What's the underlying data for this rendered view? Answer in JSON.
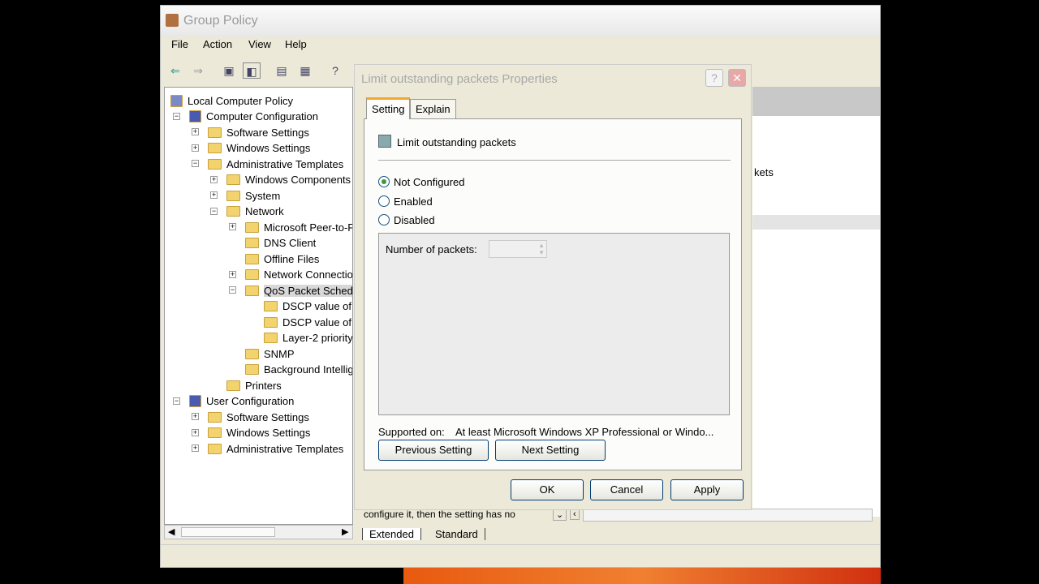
{
  "window": {
    "title": "Group Policy",
    "icon": "group-policy-icon"
  },
  "menu": [
    "File",
    "Action",
    "View",
    "Help"
  ],
  "toolbar": [
    "back-icon",
    "forward-icon",
    "up-folder-icon",
    "show-hide-tree-icon",
    "properties-icon",
    "export-list-icon",
    "help-icon"
  ],
  "tree": [
    {
      "label": "Local Computer Policy",
      "level": 0,
      "exp": "",
      "icon": "policy"
    },
    {
      "label": "Computer Configuration",
      "level": 0,
      "exp": "-",
      "icon": "computer"
    },
    {
      "label": "Software Settings",
      "level": 1,
      "exp": "+"
    },
    {
      "label": "Windows Settings",
      "level": 1,
      "exp": "+"
    },
    {
      "label": "Administrative Templates",
      "level": 1,
      "exp": "-"
    },
    {
      "label": "Windows Components",
      "level": 2,
      "exp": "+"
    },
    {
      "label": "System",
      "level": 2,
      "exp": "+"
    },
    {
      "label": "Network",
      "level": 2,
      "exp": "-"
    },
    {
      "label": "Microsoft Peer-to-F",
      "level": 3,
      "exp": "+"
    },
    {
      "label": "DNS Client",
      "level": 3,
      "exp": ""
    },
    {
      "label": "Offline Files",
      "level": 3,
      "exp": ""
    },
    {
      "label": "Network Connectio",
      "level": 3,
      "exp": "+"
    },
    {
      "label": "QoS Packet Schedu",
      "level": 3,
      "exp": "-",
      "selected": true
    },
    {
      "label": "DSCP value of",
      "level": 4,
      "exp": ""
    },
    {
      "label": "DSCP value of",
      "level": 4,
      "exp": ""
    },
    {
      "label": "Layer-2 priority",
      "level": 4,
      "exp": ""
    },
    {
      "label": "SNMP",
      "level": 3,
      "exp": ""
    },
    {
      "label": "Background Intellig",
      "level": 3,
      "exp": ""
    },
    {
      "label": "Printers",
      "level": 2,
      "exp": ""
    },
    {
      "label": "User Configuration",
      "level": 0,
      "exp": "-",
      "icon": "user"
    },
    {
      "label": "Software Settings",
      "level": 1,
      "exp": "+"
    },
    {
      "label": "Windows Settings",
      "level": 1,
      "exp": "+"
    },
    {
      "label": "Administrative Templates",
      "level": 1,
      "exp": "+"
    }
  ],
  "right": {
    "partial_text": "kets",
    "description": "configure it, then the setting has no",
    "tabs": [
      "Extended",
      "Standard"
    ]
  },
  "dialog": {
    "title": "Limit outstanding packets Properties",
    "tabs": [
      "Setting",
      "Explain"
    ],
    "setting_name": "Limit outstanding packets",
    "options": [
      {
        "label": "Not Configured",
        "checked": true
      },
      {
        "label": "Enabled",
        "checked": false
      },
      {
        "label": "Disabled",
        "checked": false
      }
    ],
    "packets_label": "Number of packets:",
    "packets_value": "",
    "supported_label": "Supported on:",
    "supported_value": "At least Microsoft Windows XP Professional or Windo...",
    "prev": "Previous Setting",
    "next": "Next Setting",
    "ok": "OK",
    "cancel": "Cancel",
    "apply": "Apply"
  }
}
